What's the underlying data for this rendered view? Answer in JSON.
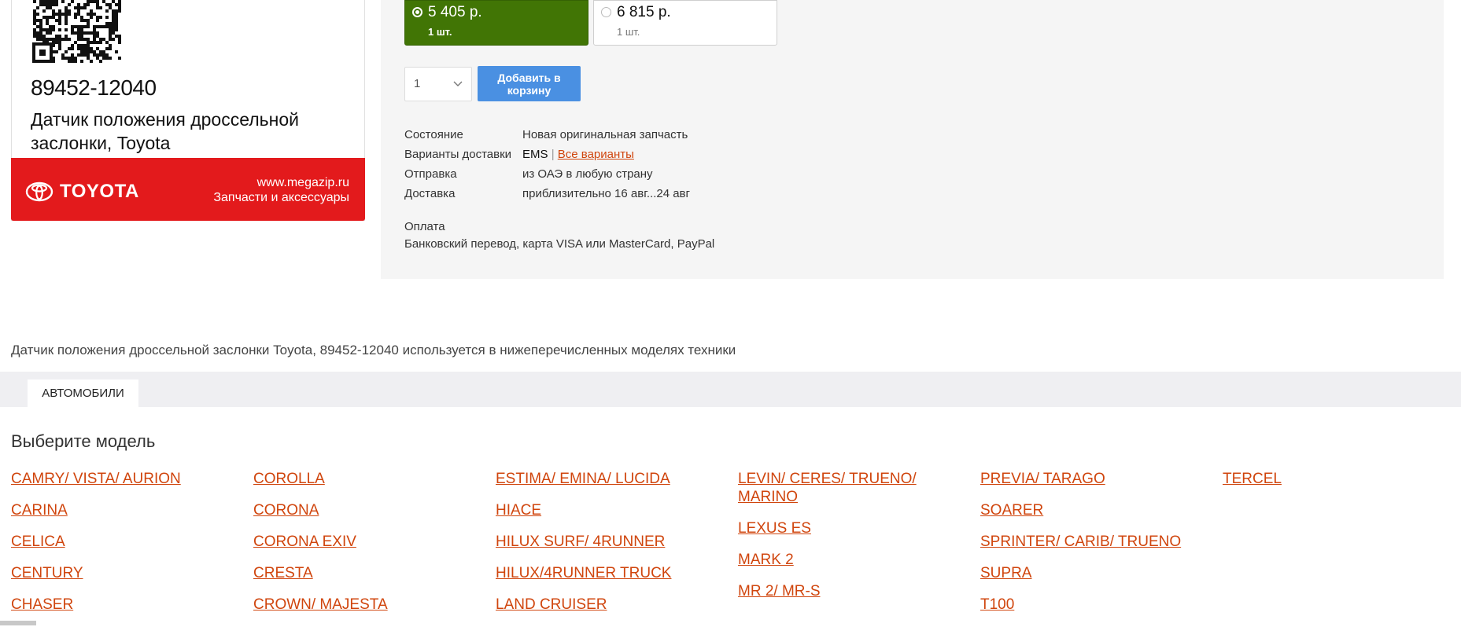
{
  "product": {
    "part_number": "89452-12040",
    "name": "Датчик положения дроссельной заслонки, Toyota",
    "banner": {
      "brand": "TOYOTA",
      "site": "www.megazip.ru",
      "tagline": "Запчасти и аксессуары",
      "color": "#e31a1c"
    },
    "icons": {
      "qr": "qr-code-icon",
      "brand_logo": "toyota-logo-icon"
    }
  },
  "offers": [
    {
      "price": "5 405 р.",
      "qty": "1 шт.",
      "selected": true,
      "color": "#417505"
    },
    {
      "price": "6 815 р.",
      "qty": "1 шт.",
      "selected": false
    }
  ],
  "cart": {
    "quantity": "1",
    "add_label": "Добавить в корзину",
    "button_color": "#4a90e2"
  },
  "info": {
    "condition_label": "Состояние",
    "condition_value": "Новая оригинальная запчасть",
    "delivery_options_label": "Варианты доставки",
    "delivery_method": "EMS",
    "separator": "|",
    "all_options_link": "Все варианты",
    "shipping_label": "Отправка",
    "shipping_value": "из ОАЭ в любую страну",
    "delivery_label": "Доставка",
    "delivery_value": "приблизительно 16 авг...24 авг",
    "payment_label": "Оплата",
    "payment_value": "Банковский перевод, карта VISA или MasterCard, PayPal"
  },
  "usage_text": "Датчик положения дроссельной заслонки Toyota, 89452-12040 используется в нижеперечисленных моделях техники",
  "tabs": [
    {
      "label": "АВТОМОБИЛИ",
      "active": true
    }
  ],
  "choose_model": "Выберите модель",
  "link_color": "#d0450d",
  "models": [
    [
      "CAMRY/ VISTA/ AURION",
      "CARINA",
      "CELICA",
      "CENTURY",
      "CHASER"
    ],
    [
      "COROLLA",
      "CORONA",
      "CORONA EXIV",
      "CRESTA",
      "CROWN/ MAJESTA"
    ],
    [
      "ESTIMA/ EMINA/ LUCIDA",
      "HIACE",
      "HILUX SURF/ 4RUNNER",
      "HILUX/4RUNNER TRUCK",
      "LAND CRUISER"
    ],
    [
      "LEVIN/ CERES/ TRUENO/ MARINO",
      "LEXUS ES",
      "MARK 2",
      "MR 2/ MR-S"
    ],
    [
      "PREVIA/ TARAGO",
      "SOARER",
      "SPRINTER/ CARIB/ TRUENO",
      "SUPRA",
      "T100"
    ],
    [
      "TERCEL"
    ]
  ]
}
